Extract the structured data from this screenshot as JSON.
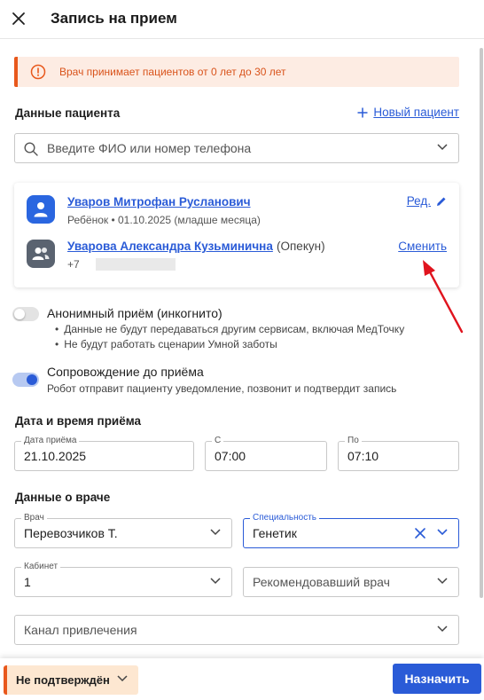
{
  "header": {
    "title": "Запись на прием",
    "close_icon": "close-icon"
  },
  "alert": {
    "text": "Врач принимает пациентов от 0 лет до 30 лет",
    "icon": "alert-circle-icon",
    "color": "#e8581c"
  },
  "patient_section": {
    "title": "Данные пациента",
    "new_patient_label": "Новый пациент",
    "search_placeholder": "Введите ФИО или номер телефона"
  },
  "patient_card": {
    "child": {
      "name": "Уваров Митрофан Русланович",
      "details": "Ребёнок • 01.10.2025 (младше месяца)",
      "edit_label": "Ред."
    },
    "guardian": {
      "name": "Уварова Александра Кузьминична",
      "role": "(Опекун)",
      "phone_prefix": "+7",
      "change_label": "Сменить"
    }
  },
  "anonymous": {
    "label": "Анонимный приём (инкогнито)",
    "enabled": false,
    "notes": [
      "Данные не будут передаваться другим сервисам, включая МедТочку",
      "Не будут работать сценарии Умной заботы"
    ]
  },
  "escort": {
    "label": "Сопровождение до приёма",
    "enabled": true,
    "hint": "Робот отправит пациенту уведомление, позвонит и подтвердит запись"
  },
  "datetime_section": {
    "title": "Дата и время приёма",
    "date_label": "Дата приёма",
    "date_value": "21.10.2025",
    "from_label": "С",
    "from_value": "07:00",
    "to_label": "По",
    "to_value": "07:10"
  },
  "doctor_section": {
    "title": "Данные о враче",
    "doctor_label": "Врач",
    "doctor_value": "Перевозчиков Т.",
    "specialty_label": "Специальность",
    "specialty_value": "Генетик",
    "room_label": "Кабинет",
    "room_value": "1",
    "referrer_placeholder": "Рекомендовавший врач",
    "channel_placeholder": "Канал привлечения"
  },
  "footer": {
    "status_label": "Не подтверждён",
    "assign_label": "Назначить"
  },
  "colors": {
    "accent": "#2a5bd7",
    "warning": "#e8581c",
    "warning_bg": "#fdece3"
  }
}
